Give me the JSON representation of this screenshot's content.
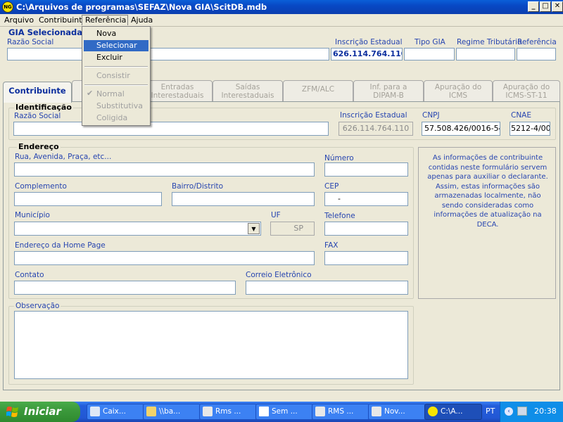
{
  "window": {
    "icon_text": "NG",
    "title": "C:\\Arquivos de programas\\SEFAZ\\Nova GIA\\ScitDB.mdb",
    "buttons": {
      "minimize": "_",
      "maximize": "□",
      "close": "✕"
    }
  },
  "menubar": {
    "items": [
      "Arquivo",
      "Contribuinte",
      "Referência",
      "Ajuda"
    ]
  },
  "dropdown": {
    "items": [
      {
        "label": "Nova",
        "state": "normal"
      },
      {
        "label": "Selecionar",
        "state": "highlighted"
      },
      {
        "label": "Excluir",
        "state": "normal"
      },
      {
        "label": "Consistir",
        "state": "disabled"
      },
      {
        "label": "Normal",
        "state": "disabled-checked"
      },
      {
        "label": "Substitutiva",
        "state": "disabled"
      },
      {
        "label": "Coligida",
        "state": "disabled"
      }
    ]
  },
  "gia": {
    "title": "GIA Selecionada",
    "razao_label": "Razão Social",
    "razao_value": "",
    "ie_label": "Inscrição Estadual",
    "ie_value": "626.114.764.110",
    "tipo_label": "Tipo GIA",
    "tipo_value": "",
    "regime_label": "Regime Tributário",
    "regime_value": "",
    "ref_label": "Referência",
    "ref_value": ""
  },
  "tabs": [
    {
      "label": "Contribuinte",
      "active": true
    },
    {
      "label": "Entradas Interestaduais",
      "line1": "Entradas",
      "line2": "Interestaduais"
    },
    {
      "label": "Saídas Interestaduais",
      "line1": "Saídas",
      "line2": "Interestaduais"
    },
    {
      "label": "ZFM/ALC"
    },
    {
      "label": "Inf. para a DIPAM-B",
      "line1": "Inf. para a",
      "line2": "DIPAM-B"
    },
    {
      "label": "Apuração do ICMS",
      "line1": "Apuração do",
      "line2": "ICMS"
    },
    {
      "label": "Apuração do ICMS-ST-11",
      "line1": "Apuração do",
      "line2": "ICMS-ST-11"
    }
  ],
  "identificacao": {
    "title": "Identificação",
    "razao_label": "Razão Social",
    "razao_value": "",
    "ie_label": "Inscrição Estadual",
    "ie_value": "626.114.764.110",
    "cnpj_label": "CNPJ",
    "cnpj_value": "57.508.426/0016-54",
    "cnae_label": "CNAE",
    "cnae_value": "5212-4/00"
  },
  "endereco": {
    "title": "Endereço",
    "rua_label": "Rua, Avenida, Praça, etc...",
    "rua_value": "",
    "numero_label": "Número",
    "numero_value": "",
    "complemento_label": "Complemento",
    "complemento_value": "",
    "bairro_label": "Bairro/Distrito",
    "bairro_value": "",
    "cep_label": "CEP",
    "cep_value": "-",
    "municipio_label": "Município",
    "municipio_value": "",
    "uf_label": "UF",
    "uf_value": "SP",
    "telefone_label": "Telefone",
    "telefone_value": "",
    "homepage_label": "Endereço da Home Page",
    "homepage_value": "",
    "fax_label": "FAX",
    "fax_value": "",
    "contato_label": "Contato",
    "contato_value": "",
    "email_label": "Correio Eletrônico",
    "email_value": ""
  },
  "info_text": "As informações de contribuinte contidas neste formulário servem apenas para auxiliar o declarante. Assim, estas informações são armazenadas localmente, não sendo consideradas como informações de atualização na DECA.",
  "observacao": {
    "title": "Observação",
    "value": ""
  },
  "taskbar": {
    "start_label": "Iniciar",
    "items": [
      {
        "label": "Caix...",
        "icon": "outlook-icon"
      },
      {
        "label": "\\\\ba...",
        "icon": "folder-icon"
      },
      {
        "label": "Rms ...",
        "icon": "rms-icon"
      },
      {
        "label": "Sem ...",
        "icon": "notepad-icon"
      },
      {
        "label": "RMS ...",
        "icon": "rms-icon"
      },
      {
        "label": "Nov...",
        "icon": "rms-icon"
      },
      {
        "label": "C:\\A...",
        "icon": "ng-icon",
        "active": true
      }
    ],
    "lang": "PT",
    "clock": "20:38"
  },
  "colors": {
    "title_blue": "#0a4fd0",
    "label_blue": "#2745b0",
    "highlight": "#316ac5",
    "face": "#ece9d8"
  }
}
